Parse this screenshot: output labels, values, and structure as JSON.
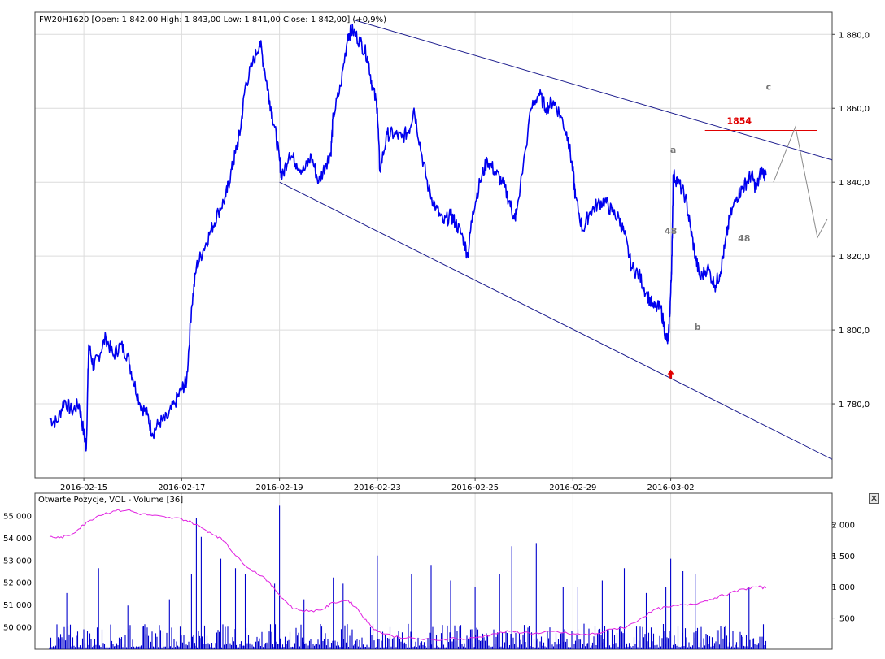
{
  "colors": {
    "price": "#0000ee",
    "channel": "#1a1a8c",
    "target": "#e00000",
    "projection": "#8a8a8a",
    "wave_label": "#777777",
    "volume": "#0000cc",
    "open_interest": "#e020e0",
    "grid": "#dcdcdc",
    "arrow": "#e00000"
  },
  "icons": {
    "close": "close-x-icon",
    "signal_arrow": "arrow-up-icon"
  },
  "panel": {
    "close_symbol": "✕"
  },
  "chart_data": [
    {
      "type": "line",
      "title": "FW20H1620 [Open: 1 842,00  High: 1 843,00  Low: 1 841,00  Close: 1 842,00] (+0,9%)",
      "xlabel": "",
      "ylabel": "",
      "ylim": [
        1760,
        1886
      ],
      "grid": true,
      "y_axis_side": "right",
      "y_ticks": [
        1780,
        1800,
        1820,
        1840,
        1860,
        1880
      ],
      "y_tick_labels": [
        "1 780,0",
        "1 800,0",
        "1 820,0",
        "1 840,0",
        "1 860,0",
        "1 880,0"
      ],
      "x_ticks": [
        {
          "pos": 2,
          "label": "2016-02-15"
        },
        {
          "pos": 6,
          "label": "2016-02-17"
        },
        {
          "pos": 10,
          "label": "2016-02-19"
        },
        {
          "pos": 14,
          "label": "2016-02-23"
        },
        {
          "pos": 18,
          "label": "2016-02-25"
        },
        {
          "pos": 22,
          "label": "2016-02-29"
        },
        {
          "pos": 26,
          "label": "2016-03-02"
        }
      ],
      "x_range": [
        0,
        32.6
      ],
      "series": [
        {
          "points": [
            [
              0.6,
              1776
            ],
            [
              0.9,
              1775
            ],
            [
              1.2,
              1781
            ],
            [
              1.5,
              1778
            ],
            [
              1.8,
              1780
            ],
            [
              2.0,
              1772
            ],
            [
              2.1,
              1768
            ],
            [
              2.2,
              1796
            ],
            [
              2.4,
              1790
            ],
            [
              2.6,
              1793
            ],
            [
              2.9,
              1798
            ],
            [
              3.2,
              1793
            ],
            [
              3.5,
              1796
            ],
            [
              3.8,
              1793
            ],
            [
              4.0,
              1787
            ],
            [
              4.3,
              1780
            ],
            [
              4.6,
              1777
            ],
            [
              4.8,
              1772
            ],
            [
              5.1,
              1775
            ],
            [
              5.4,
              1776
            ],
            [
              5.7,
              1780
            ],
            [
              6.0,
              1784
            ],
            [
              6.2,
              1786
            ],
            [
              6.4,
              1806
            ],
            [
              6.6,
              1817
            ],
            [
              6.9,
              1822
            ],
            [
              7.2,
              1827
            ],
            [
              7.5,
              1832
            ],
            [
              7.8,
              1836
            ],
            [
              8.0,
              1842
            ],
            [
              8.2,
              1848
            ],
            [
              8.4,
              1854
            ],
            [
              8.6,
              1866
            ],
            [
              8.9,
              1872
            ],
            [
              9.2,
              1878
            ],
            [
              9.4,
              1870
            ],
            [
              9.6,
              1862
            ],
            [
              9.8,
              1855
            ],
            [
              10.0,
              1846
            ],
            [
              10.1,
              1841
            ],
            [
              10.4,
              1848
            ],
            [
              10.7,
              1845
            ],
            [
              11.0,
              1843
            ],
            [
              11.3,
              1847
            ],
            [
              11.6,
              1840
            ],
            [
              11.9,
              1845
            ],
            [
              12.1,
              1848
            ],
            [
              12.2,
              1858
            ],
            [
              12.5,
              1866
            ],
            [
              12.8,
              1880
            ],
            [
              13.0,
              1881
            ],
            [
              13.3,
              1878
            ],
            [
              13.6,
              1874
            ],
            [
              13.8,
              1866
            ],
            [
              14.0,
              1860
            ],
            [
              14.1,
              1843
            ],
            [
              14.4,
              1853
            ],
            [
              14.7,
              1853
            ],
            [
              15.0,
              1852
            ],
            [
              15.3,
              1854
            ],
            [
              15.5,
              1860
            ],
            [
              15.8,
              1848
            ],
            [
              16.1,
              1838
            ],
            [
              16.4,
              1833
            ],
            [
              16.7,
              1829
            ],
            [
              17.0,
              1831
            ],
            [
              17.2,
              1829
            ],
            [
              17.5,
              1825
            ],
            [
              17.7,
              1820
            ],
            [
              17.9,
              1832
            ],
            [
              18.2,
              1840
            ],
            [
              18.5,
              1846
            ],
            [
              18.8,
              1843
            ],
            [
              19.1,
              1840
            ],
            [
              19.4,
              1835
            ],
            [
              19.6,
              1830
            ],
            [
              19.7,
              1832
            ],
            [
              20.3,
              1860
            ],
            [
              20.6,
              1864
            ],
            [
              20.9,
              1860
            ],
            [
              21.2,
              1862
            ],
            [
              21.5,
              1858
            ],
            [
              21.8,
              1852
            ],
            [
              22.0,
              1843
            ],
            [
              22.1,
              1836
            ],
            [
              22.4,
              1827
            ],
            [
              22.7,
              1832
            ],
            [
              23.0,
              1834
            ],
            [
              23.3,
              1835
            ],
            [
              23.6,
              1832
            ],
            [
              23.9,
              1830
            ],
            [
              24.1,
              1826
            ],
            [
              24.4,
              1817
            ],
            [
              24.7,
              1815
            ],
            [
              25.0,
              1810
            ],
            [
              25.3,
              1806
            ],
            [
              25.6,
              1806
            ],
            [
              25.8,
              1798
            ],
            [
              25.9,
              1797
            ],
            [
              26.0,
              1810
            ],
            [
              26.05,
              1820
            ],
            [
              26.1,
              1842
            ],
            [
              26.3,
              1840
            ],
            [
              26.6,
              1836
            ],
            [
              26.8,
              1828
            ],
            [
              27.0,
              1820
            ],
            [
              27.2,
              1814
            ],
            [
              27.5,
              1817
            ],
            [
              27.8,
              1812
            ],
            [
              28.0,
              1815
            ],
            [
              28.2,
              1822
            ],
            [
              28.4,
              1830
            ],
            [
              28.7,
              1836
            ],
            [
              28.9,
              1838
            ],
            [
              29.1,
              1840
            ],
            [
              29.3,
              1842
            ],
            [
              29.5,
              1838
            ],
            [
              29.7,
              1843
            ],
            [
              29.9,
              1842
            ]
          ]
        }
      ],
      "channel": {
        "upper": [
          [
            13.0,
            1884
          ],
          [
            32.6,
            1846
          ]
        ],
        "lower": [
          [
            10.0,
            1840
          ],
          [
            32.6,
            1765
          ]
        ]
      },
      "target": {
        "label": "1854",
        "level": 1854,
        "x_from": 27.4,
        "x_to": 32.0
      },
      "projection": [
        [
          30.2,
          1840
        ],
        [
          31.1,
          1855
        ],
        [
          32.0,
          1825
        ],
        [
          32.4,
          1830
        ]
      ],
      "wave_labels": [
        {
          "text": "a",
          "x": 26.1,
          "y": 1848
        },
        {
          "text": "b",
          "x": 27.1,
          "y": 1800
        },
        {
          "text": "c",
          "x": 30.0,
          "y": 1865
        },
        {
          "text": "48",
          "x": 26.0,
          "y": 1826
        },
        {
          "text": "48",
          "x": 29.0,
          "y": 1824
        }
      ],
      "signal_arrow": {
        "x": 26.0,
        "y": 1788
      }
    },
    {
      "type": "bar",
      "title": "Otwarte Pozycje, VOL - Volume [36]",
      "xlabel": "",
      "ylabel": "",
      "ylim_left": [
        49000,
        56000
      ],
      "ylim_right": [
        0,
        2500
      ],
      "left_ticks": [
        50000,
        51000,
        52000,
        53000,
        54000,
        55000
      ],
      "left_tick_labels": [
        "50 000",
        "51 000",
        "52 000",
        "53 000",
        "54 000",
        "55 000"
      ],
      "right_ticks": [
        500,
        1000,
        1500,
        2000
      ],
      "right_tick_labels": [
        "500",
        "1 000",
        "1 500",
        "2 000"
      ],
      "series": [
        {
          "kind": "volume",
          "peaks": [
            [
              1.3,
              900
            ],
            [
              2.6,
              1300
            ],
            [
              3.8,
              700
            ],
            [
              5.5,
              800
            ],
            [
              6.4,
              1200
            ],
            [
              6.6,
              2100
            ],
            [
              6.8,
              1800
            ],
            [
              7.6,
              1450
            ],
            [
              8.2,
              1300
            ],
            [
              8.6,
              1200
            ],
            [
              9.8,
              1050
            ],
            [
              10.0,
              2300
            ],
            [
              11.0,
              800
            ],
            [
              12.2,
              1150
            ],
            [
              12.6,
              1050
            ],
            [
              14.0,
              1500
            ],
            [
              15.4,
              1200
            ],
            [
              16.2,
              1350
            ],
            [
              17.0,
              1100
            ],
            [
              18.0,
              1000
            ],
            [
              19.0,
              1200
            ],
            [
              19.5,
              1650
            ],
            [
              20.5,
              1700
            ],
            [
              21.6,
              1000
            ],
            [
              22.2,
              1000
            ],
            [
              23.2,
              1100
            ],
            [
              24.1,
              1300
            ],
            [
              25.0,
              900
            ],
            [
              25.8,
              1000
            ],
            [
              26.0,
              1450
            ],
            [
              26.5,
              1250
            ],
            [
              27.0,
              1200
            ],
            [
              28.4,
              900
            ],
            [
              29.2,
              1000
            ]
          ],
          "x_range": [
            0.6,
            29.9
          ]
        },
        {
          "kind": "open_interest",
          "points": [
            [
              0.6,
              54050
            ],
            [
              1.0,
              54000
            ],
            [
              1.4,
              54100
            ],
            [
              1.8,
              54400
            ],
            [
              2.1,
              54700
            ],
            [
              2.6,
              55000
            ],
            [
              3.2,
              55200
            ],
            [
              3.8,
              55250
            ],
            [
              4.2,
              55100
            ],
            [
              4.8,
              55000
            ],
            [
              5.4,
              54900
            ],
            [
              6.0,
              54850
            ],
            [
              6.4,
              54700
            ],
            [
              6.9,
              54400
            ],
            [
              7.4,
              54100
            ],
            [
              7.8,
              53800
            ],
            [
              8.2,
              53200
            ],
            [
              8.8,
              52600
            ],
            [
              9.4,
              52200
            ],
            [
              9.8,
              51700
            ],
            [
              10.2,
              51200
            ],
            [
              10.6,
              50800
            ],
            [
              11.2,
              50700
            ],
            [
              11.8,
              50800
            ],
            [
              12.2,
              51100
            ],
            [
              12.8,
              51200
            ],
            [
              13.2,
              50800
            ],
            [
              13.6,
              50200
            ],
            [
              14.0,
              49800
            ],
            [
              14.6,
              49600
            ],
            [
              15.2,
              49500
            ],
            [
              15.8,
              49450
            ],
            [
              16.4,
              49400
            ],
            [
              17.0,
              49500
            ],
            [
              17.6,
              49450
            ],
            [
              18.2,
              49550
            ],
            [
              18.8,
              49700
            ],
            [
              19.4,
              49800
            ],
            [
              20.0,
              49750
            ],
            [
              20.6,
              49700
            ],
            [
              21.2,
              49800
            ],
            [
              21.8,
              49700
            ],
            [
              22.4,
              49650
            ],
            [
              23.0,
              49700
            ],
            [
              23.6,
              49900
            ],
            [
              24.2,
              50000
            ],
            [
              24.8,
              50400
            ],
            [
              25.4,
              50800
            ],
            [
              26.0,
              50900
            ],
            [
              26.6,
              51000
            ],
            [
              27.2,
              51100
            ],
            [
              27.8,
              51300
            ],
            [
              28.4,
              51500
            ],
            [
              29.0,
              51700
            ],
            [
              29.5,
              51800
            ],
            [
              29.9,
              51750
            ]
          ]
        }
      ]
    }
  ]
}
